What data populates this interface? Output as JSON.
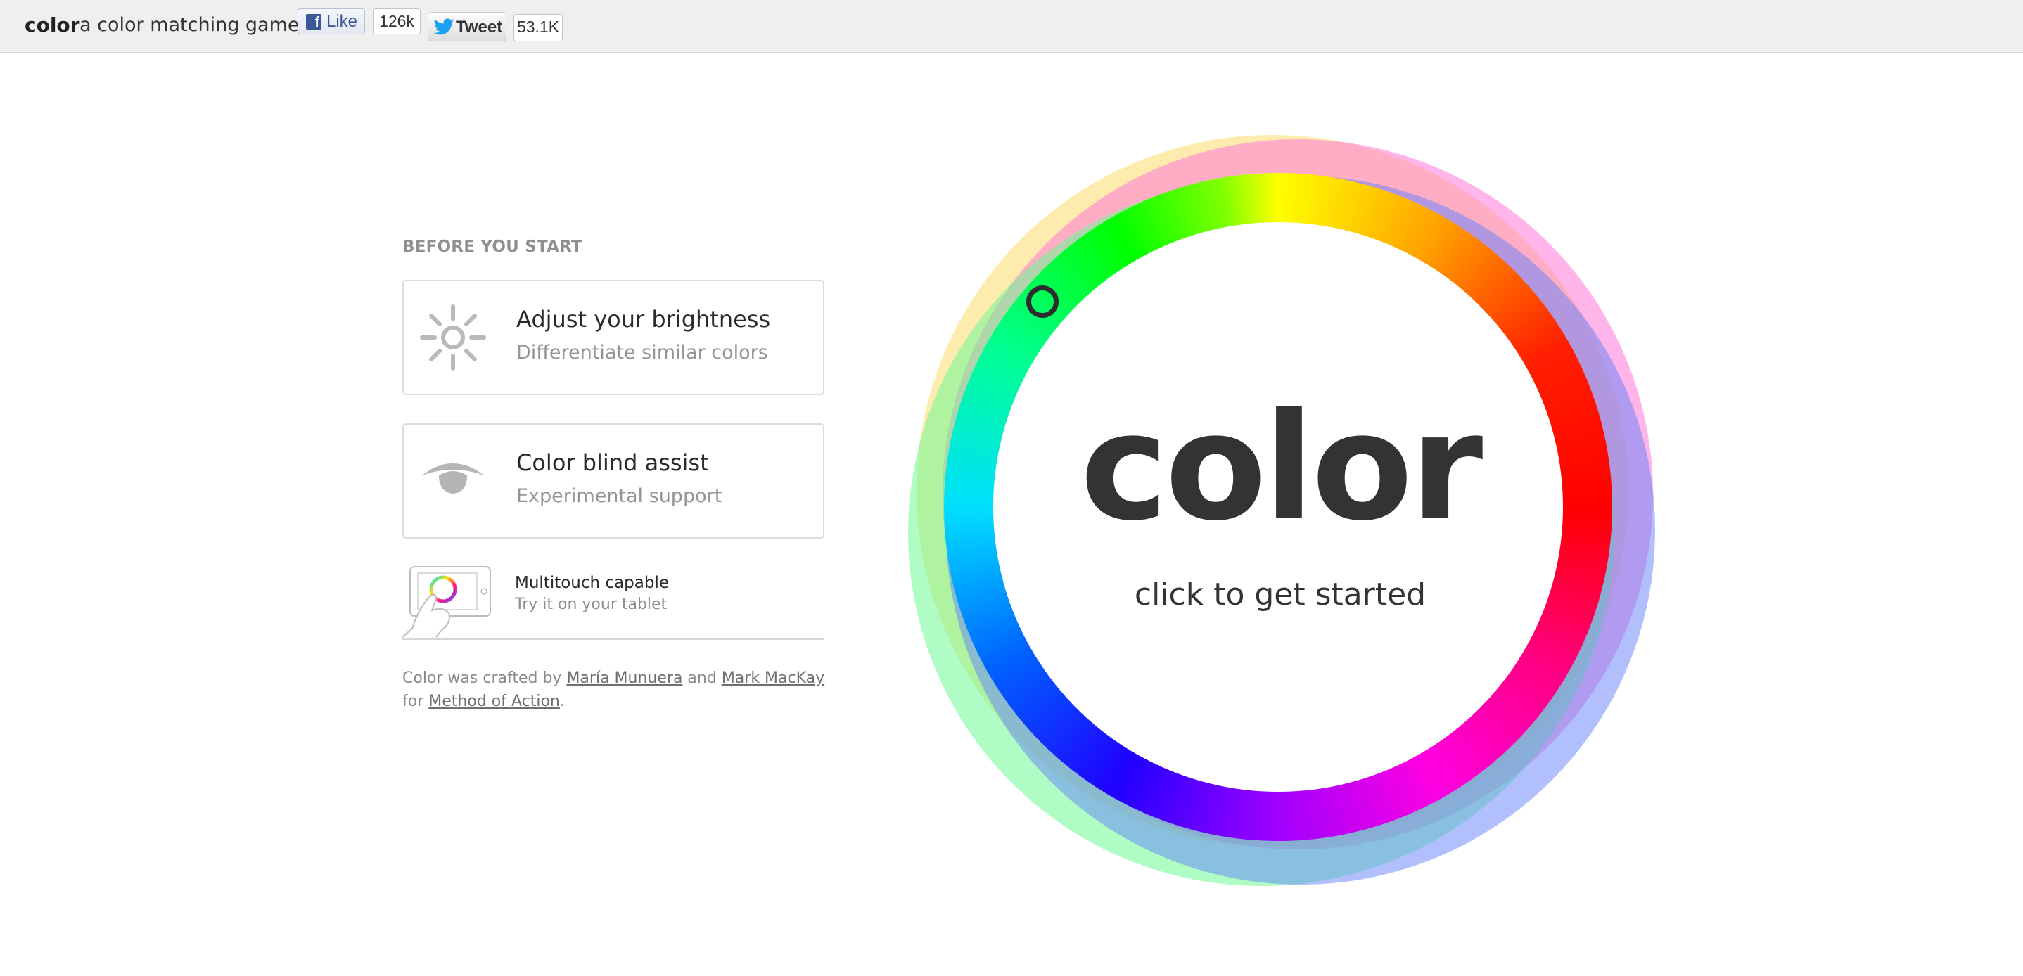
{
  "header": {
    "brand": "color",
    "tagline": "a color matching game",
    "facebook": {
      "label": "Like",
      "count": "126k"
    },
    "twitter": {
      "label": "Tweet",
      "count": "53.1K"
    }
  },
  "intro": {
    "section_title": "BEFORE YOU START",
    "cards": [
      {
        "title": "Adjust your brightness",
        "subtitle": "Differentiate similar colors",
        "icon": "sun-icon"
      },
      {
        "title": "Color blind assist",
        "subtitle": "Experimental support",
        "icon": "eye-icon"
      }
    ],
    "multitouch": {
      "title": "Multitouch capable",
      "subtitle": "Try it on your tablet",
      "icon": "tablet-icon"
    }
  },
  "credits": {
    "prefix": "Color was crafted by",
    "author1": "María Munuera",
    "and": "and",
    "author2": "Mark MacKay",
    "for": "for",
    "company": "Method of Action",
    "suffix": "."
  },
  "wheel": {
    "title": "color",
    "cta": "click to get started"
  },
  "colors": {
    "topbar_bg": "#efefef",
    "facebook": "#3b5998",
    "twitter": "#1da1f2",
    "text_dark": "#333333",
    "text_muted": "#959595"
  }
}
